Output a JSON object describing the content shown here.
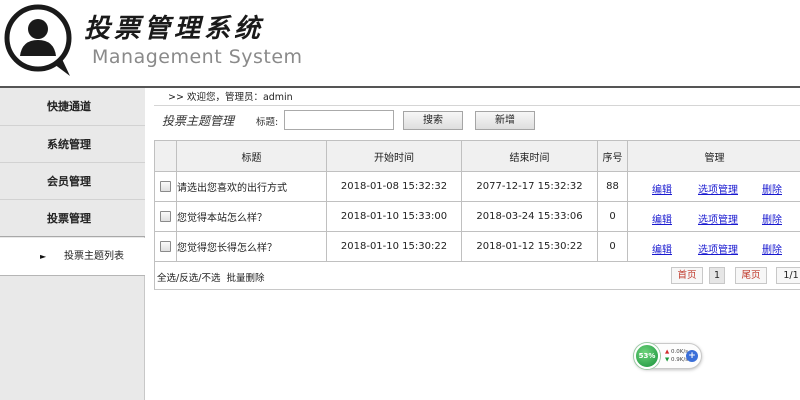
{
  "header": {
    "title": "投票管理系统",
    "subtitle": "Management System"
  },
  "sidebar": {
    "items": [
      {
        "label": "快捷通道"
      },
      {
        "label": "系统管理"
      },
      {
        "label": "会员管理"
      },
      {
        "label": "投票管理"
      }
    ],
    "sub_item": {
      "arrow": "►",
      "label": "投票主题列表"
    }
  },
  "breadcrumb": {
    "text": ">>  欢迎您，管理员：admin"
  },
  "toolbar": {
    "section_title": "投票主题管理",
    "search_label": "标题:",
    "search_value": "",
    "search_button": "搜索",
    "add_button": "新增"
  },
  "table": {
    "headers": {
      "title": "标题",
      "start": "开始时间",
      "end": "结束时间",
      "seq": "序号",
      "ops": "管理"
    },
    "rows": [
      {
        "title": "请选出您喜欢的出行方式",
        "start": "2018-01-08 15:32:32",
        "end": "2077-12-17 15:32:32",
        "seq": "88",
        "edit": "编辑",
        "options": "选项管理",
        "delete": "删除"
      },
      {
        "title": "您觉得本站怎么样？",
        "start": "2018-01-10 15:33:00",
        "end": "2018-03-24 15:33:06",
        "seq": "0",
        "edit": "编辑",
        "options": "选项管理",
        "delete": "删除"
      },
      {
        "title": "您觉得您长得怎么样？",
        "start": "2018-01-10 15:30:22",
        "end": "2018-01-12 15:30:22",
        "seq": "0",
        "edit": "编辑",
        "options": "选项管理",
        "delete": "删除"
      }
    ]
  },
  "footer": {
    "select_all": "全选",
    "invert": "反选",
    "deselect": "不选",
    "batch_delete": "批量删除",
    "pager": {
      "first": "首页",
      "current": "1",
      "last": "尾页",
      "total": "1/1"
    }
  },
  "net_widget": {
    "percent": "53%",
    "up": "0.0K/s",
    "down": "0.9K/s",
    "plus": "+"
  }
}
